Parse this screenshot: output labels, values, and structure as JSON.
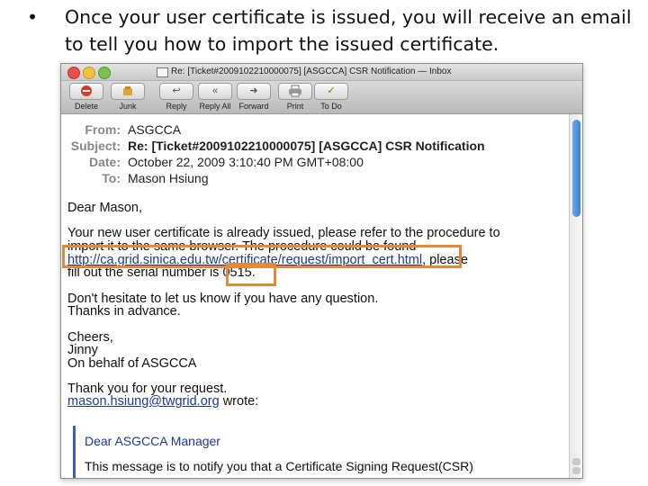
{
  "caption": {
    "bullet": "•",
    "text": "Once your user certificate is issued, you will receive an email to tell you how to import the issued certificate."
  },
  "window": {
    "title": "Re: [Ticket#2009102210000075] [ASGCCA] CSR Notification — Inbox"
  },
  "toolbar": {
    "buttons": [
      {
        "label": "Delete",
        "icon": "delete-icon"
      },
      {
        "label": "Junk",
        "icon": "junk-icon"
      },
      {
        "label": "Reply",
        "icon": "reply-icon"
      },
      {
        "label": "Reply All",
        "icon": "reply-all-icon"
      },
      {
        "label": "Forward",
        "icon": "forward-icon"
      },
      {
        "label": "Print",
        "icon": "print-icon"
      },
      {
        "label": "To Do",
        "icon": "todo-icon"
      }
    ]
  },
  "headers": [
    {
      "label": "From:",
      "value": "ASGCCA"
    },
    {
      "label": "Subject:",
      "value": "Re: [Ticket#2009102210000075] [ASGCCA] CSR Notification"
    },
    {
      "label": "Date:",
      "value": "October 22, 2009 3:10:40 PM GMT+08:00"
    },
    {
      "label": "To:",
      "value": "Mason Hsiung"
    }
  ],
  "body": {
    "greeting": "Dear Mason,",
    "p1_line1": "Your new user certificate is already issued, please refer to the procedure to",
    "p1_line2": "import it to the same browser. The procedure could be found",
    "link_url": "http://ca.grid.sinica.edu.tw/certificate/request/import_cert.html",
    "after_link": ", please",
    "p1_line4": "fill out the serial number is",
    "serial": "0515.",
    "p2_line1": "Don't hesitate to let us know if you have any question.",
    "p2_line2": "Thanks in advance.",
    "closing": "Cheers,",
    "sender_name": "Jinny",
    "sender_org": "On behalf of ASGCCA",
    "thanks": "Thank you for your request.",
    "reply_email": "mason.hsiung@twgrid.org",
    "wrote": " wrote:",
    "quote_line1": "Dear ASGCCA Manager",
    "quote_line2": "This message is to notify you that a Certificate Signing Request(CSR)"
  },
  "colors": {
    "highlight_box": "#e08a3c",
    "link": "#1a3a9a",
    "quote_bar": "#3b5fc1"
  }
}
